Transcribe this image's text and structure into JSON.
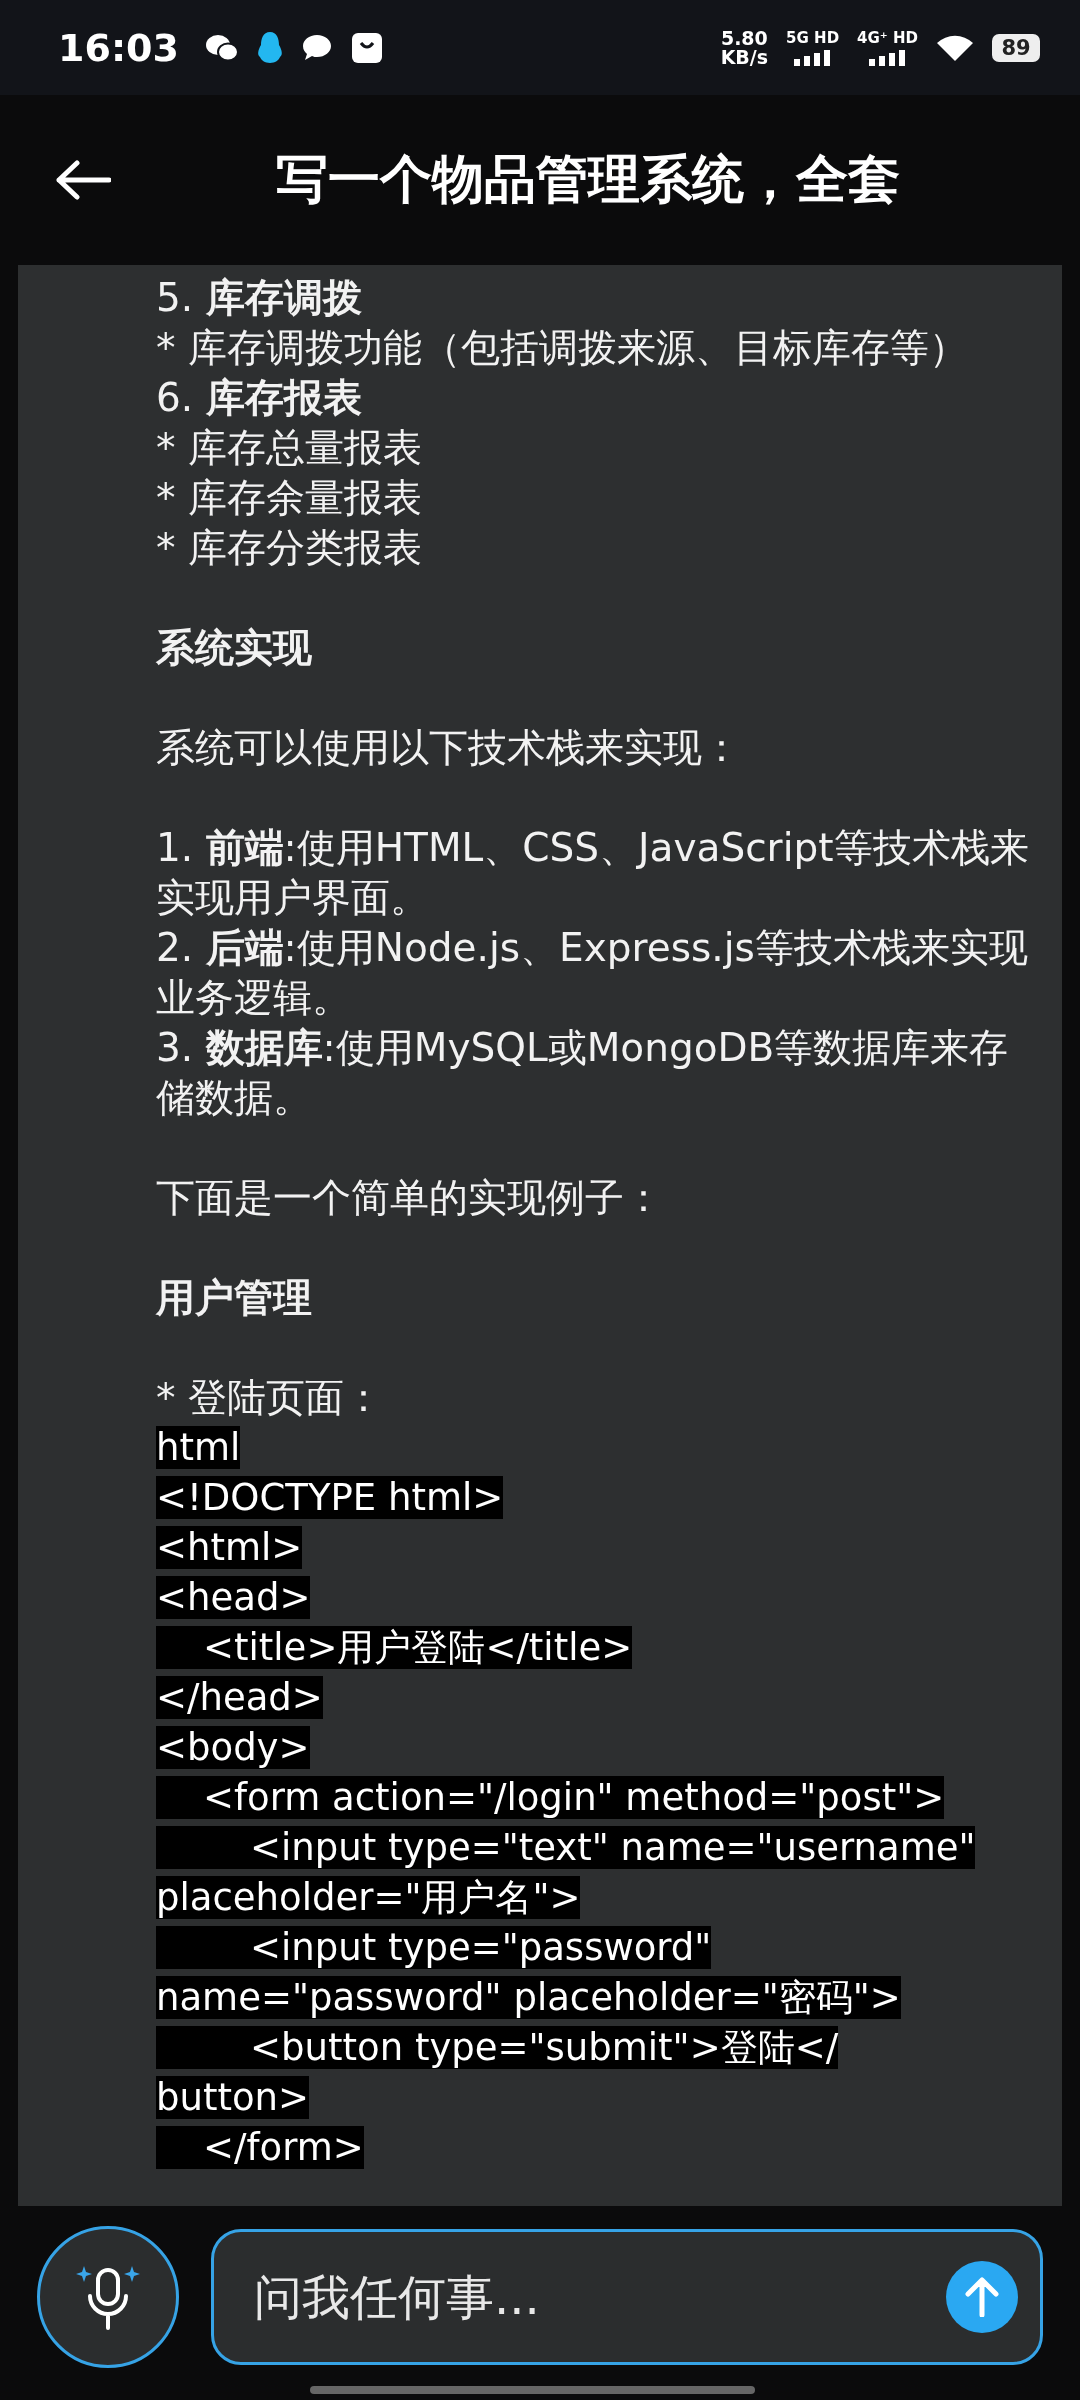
{
  "status_bar": {
    "time": "16:03",
    "speed_value": "5.80",
    "speed_unit": "KB/s",
    "sim1": "5G HD",
    "sim2": "4G⁺ HD",
    "battery": "89"
  },
  "header": {
    "title": "写一个物品管理系统，全套"
  },
  "message": {
    "sections": [
      {
        "lines": [
          {
            "kind": "text",
            "text": "5. **库存调拨**"
          },
          {
            "kind": "text",
            "text": "* 库存调拨功能（包括调拨来源、目标库存等）"
          },
          {
            "kind": "text",
            "text": "6. **库存报表**"
          },
          {
            "kind": "text",
            "text": "* 库存总量报表"
          },
          {
            "kind": "text",
            "text": "* 库存余量报表"
          },
          {
            "kind": "text",
            "text": "* 库存分类报表"
          }
        ]
      },
      {
        "lines": [
          {
            "kind": "heading",
            "text": "系统实现"
          }
        ]
      },
      {
        "lines": [
          {
            "kind": "text",
            "text": "系统可以使用以下技术栈来实现："
          }
        ]
      },
      {
        "lines": [
          {
            "kind": "text",
            "text": "1. **前端**:使用HTML、CSS、JavaScript等技术栈来实现用户界面。"
          },
          {
            "kind": "text",
            "text": "2. **后端**:使用Node.js、Express.js等技术栈来实现业务逻辑。"
          },
          {
            "kind": "text",
            "text": "3. **数据库**:使用MySQL或MongoDB等数据库来存储数据。"
          }
        ]
      },
      {
        "lines": [
          {
            "kind": "text",
            "text": "下面是一个简单的实现例子："
          }
        ]
      },
      {
        "lines": [
          {
            "kind": "heading",
            "text": "用户管理"
          }
        ]
      },
      {
        "lines": [
          {
            "kind": "text",
            "text": "* 登陆页面："
          },
          {
            "kind": "code",
            "text": "html"
          },
          {
            "kind": "code",
            "text": "<!DOCTYPE html>"
          },
          {
            "kind": "code",
            "text": "<html>"
          },
          {
            "kind": "code",
            "text": "<head>"
          },
          {
            "kind": "code",
            "text": "    <title>用户登陆</title>"
          },
          {
            "kind": "code",
            "text": "</head>"
          },
          {
            "kind": "code",
            "text": "<body>"
          },
          {
            "kind": "code",
            "text": "    <form action=\"/login\" method=\"post\">"
          },
          {
            "kind": "code",
            "text": "        <input type=\"text\" name=\"username\""
          },
          {
            "kind": "code",
            "text": "placeholder=\"用户名\">"
          },
          {
            "kind": "code",
            "text": "        <input type=\"password\""
          },
          {
            "kind": "code",
            "text": "name=\"password\" placeholder=\"密码\">"
          },
          {
            "kind": "code",
            "text": "        <button type=\"submit\">登陆</"
          },
          {
            "kind": "code",
            "text": "button>"
          },
          {
            "kind": "code",
            "text": "    </form>"
          }
        ]
      }
    ]
  },
  "composer": {
    "placeholder": "问我任何事..."
  }
}
